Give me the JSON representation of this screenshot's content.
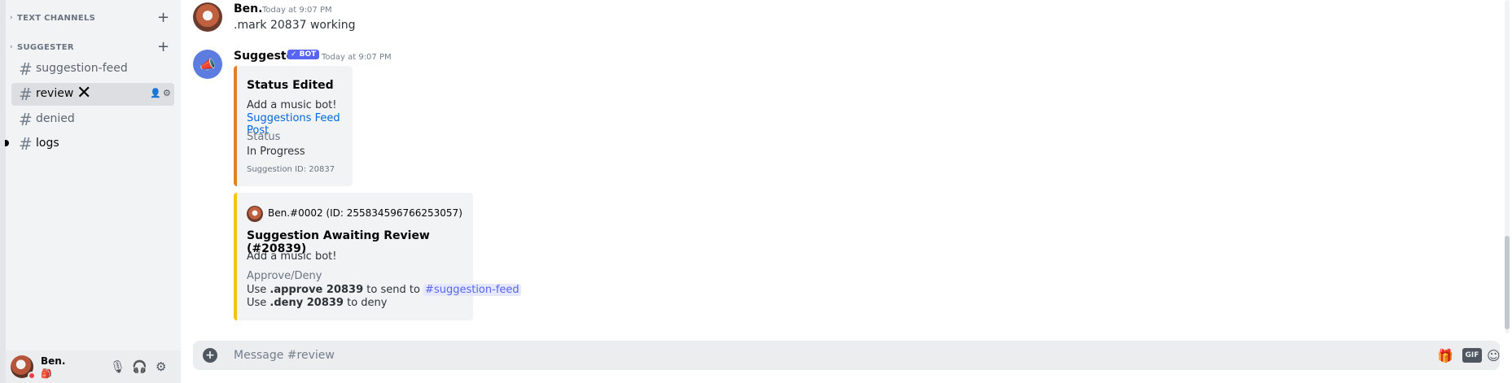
{
  "sidebar": {
    "categories": [
      {
        "label": "TEXT CHANNELS"
      },
      {
        "label": "SUGGESTER"
      }
    ],
    "channels": [
      {
        "name": "suggestion-feed"
      },
      {
        "name": "review"
      },
      {
        "name": "denied"
      },
      {
        "name": "logs"
      }
    ]
  },
  "user_panel": {
    "username": "Ben.",
    "status_glyph": "🎒"
  },
  "messages": [
    {
      "author": "Ben.",
      "timestamp": "Today at 9:07 PM",
      "content": ".mark 20837 working"
    },
    {
      "author": "Suggester",
      "bot_tag": "✓ BOT",
      "timestamp": "Today at 9:07 PM"
    }
  ],
  "embed1": {
    "accent": "#e67e22",
    "title": "Status Edited",
    "description": "Add a music bot!",
    "link": "Suggestions Feed Post",
    "field_name": "Status",
    "field_value": "In Progress",
    "footer": "Suggestion ID: 20837"
  },
  "embed2": {
    "accent": "#f1c40f",
    "author": "Ben.#0002 (ID: 255834596766253057)",
    "title": "Suggestion Awaiting Review (#20839)",
    "description": "Add a music bot!",
    "field_name": "Approve/Deny",
    "line1_prefix": "Use ",
    "line1_cmd": ".approve 20839",
    "line1_mid": " to send to ",
    "line1_mention": "#suggestion-feed",
    "line2_prefix": "Use ",
    "line2_cmd": ".deny 20839",
    "line2_suffix": " to deny"
  },
  "composer": {
    "placeholder": "Message #review",
    "gif_label": "GIF"
  },
  "colors": {
    "accent": "#5865f2",
    "sidebar_bg": "#f2f3f5",
    "chat_bg": "#ffffff"
  },
  "icons": [
    "chevron-right-icon",
    "plus-icon",
    "hash-icon",
    "close-icon",
    "add-member-icon",
    "gear-icon",
    "mute-mic-icon",
    "deafen-icon",
    "add-file-icon",
    "gift-icon",
    "gif-icon",
    "emoji-icon",
    "megaphone-icon"
  ]
}
